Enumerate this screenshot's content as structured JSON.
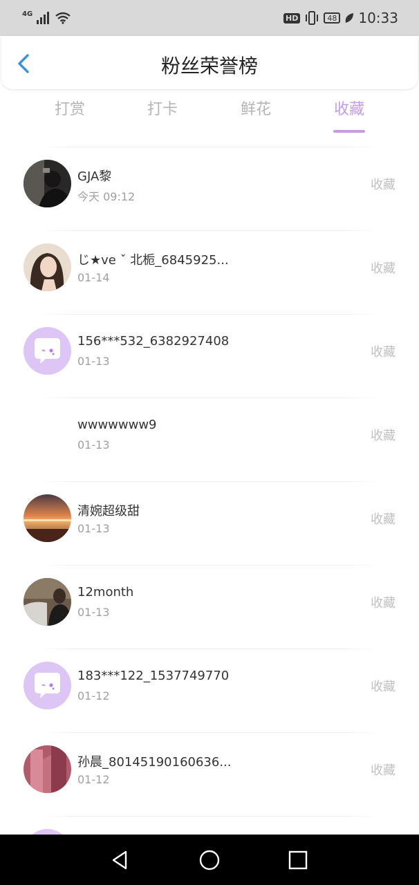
{
  "status_bar": {
    "network": "4G",
    "hd": "HD",
    "battery": "48",
    "time": "10:33"
  },
  "header": {
    "title": "粉丝荣誉榜"
  },
  "tabs": [
    {
      "label": "打赏"
    },
    {
      "label": "打卡"
    },
    {
      "label": "鲜花"
    },
    {
      "label": "收藏"
    }
  ],
  "active_tab": "收藏",
  "colors": {
    "accent": "#c69be6",
    "back_arrow": "#3d8fe0",
    "placeholder_avatar_bg": "#ddc6f6"
  },
  "list": [
    {
      "name": "GJA黎",
      "time": "今天 09:12",
      "action": "收藏",
      "avatar": "photo-dark"
    },
    {
      "name": "じ★ve ˇ 北栀_6845925...",
      "time": "01-14",
      "action": "收藏",
      "avatar": "photo-girl"
    },
    {
      "name": "156***532_6382927408",
      "time": "01-13",
      "action": "收藏",
      "avatar": "default-chat"
    },
    {
      "name": "wwwwwww9",
      "time": "01-13",
      "action": "收藏",
      "avatar": "blank"
    },
    {
      "name": "清婉超级甜",
      "time": "01-13",
      "action": "收藏",
      "avatar": "photo-sunset"
    },
    {
      "name": "12month",
      "time": "01-13",
      "action": "收藏",
      "avatar": "photo-car"
    },
    {
      "name": "183***122_1537749770",
      "time": "01-12",
      "action": "收藏",
      "avatar": "default-chat"
    },
    {
      "name": "孙晨_80145190160636...",
      "time": "01-12",
      "action": "收藏",
      "avatar": "photo-pink"
    }
  ]
}
